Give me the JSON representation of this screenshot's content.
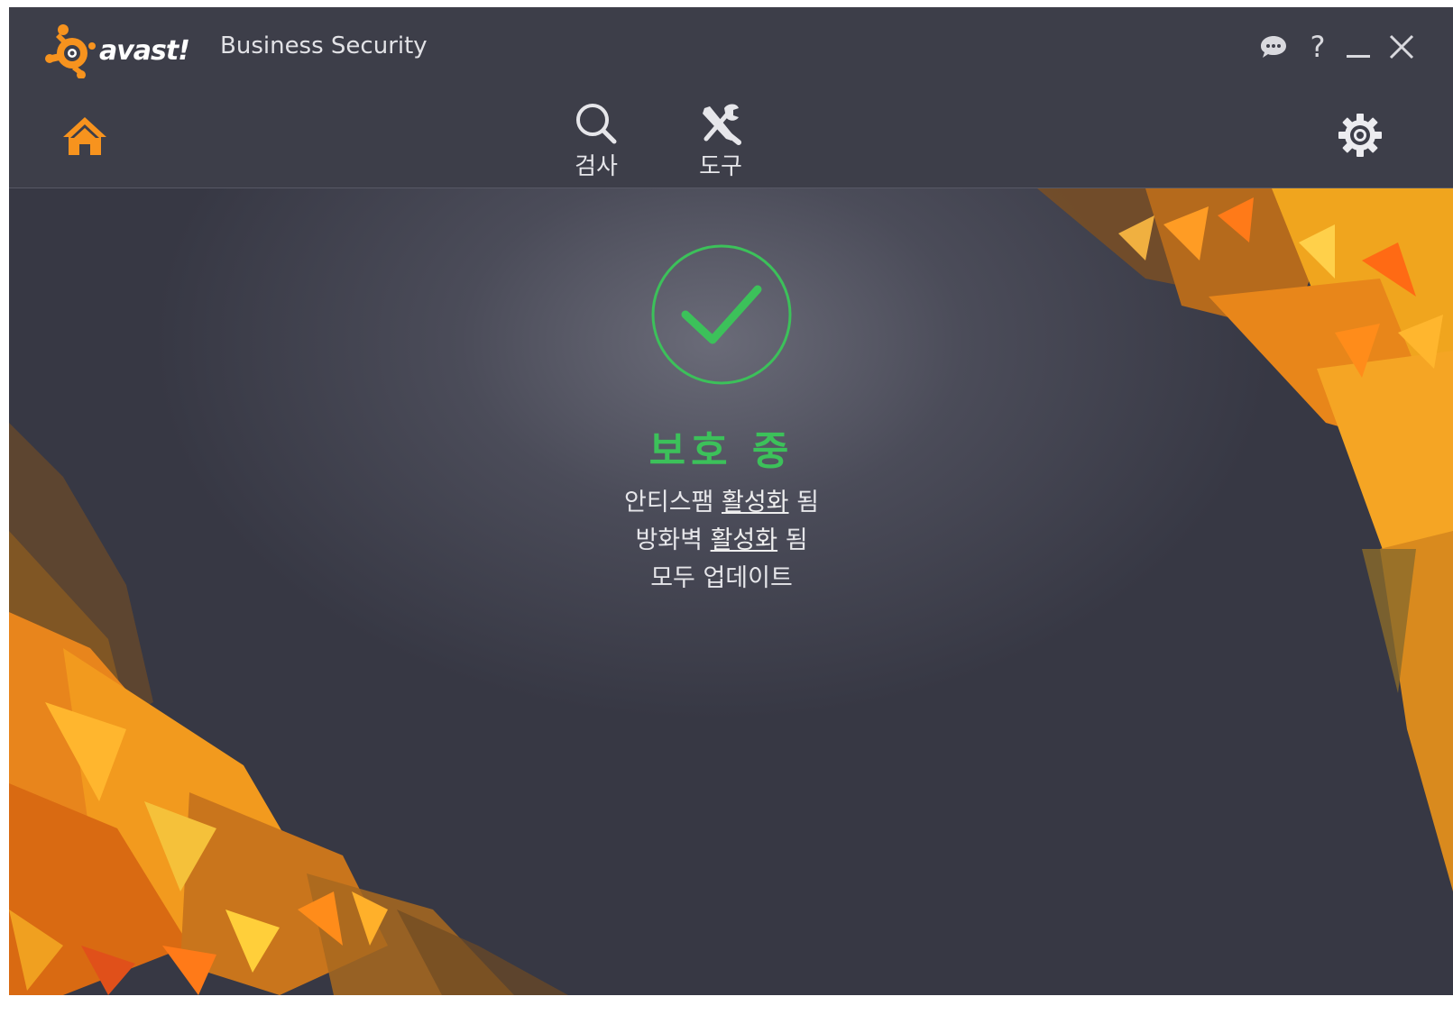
{
  "app": {
    "logo_text": "avast!",
    "product_name": "Business Security",
    "accent_color": "#f7931e",
    "status_color": "#3cc15a"
  },
  "window_controls": {
    "chat_icon": "chat-bubble-icon",
    "help_label": "?",
    "minimize_icon": "minimize-icon",
    "close_icon": "close-icon"
  },
  "nav": {
    "home_icon": "home-icon",
    "items": [
      {
        "label": "검사",
        "icon": "search-icon"
      },
      {
        "label": "도구",
        "icon": "tools-icon"
      }
    ],
    "settings_icon": "gear-icon"
  },
  "status": {
    "icon": "check-circle-icon",
    "title": "보호 중",
    "lines": [
      {
        "prefix": "안티스팸",
        "link": "활성화",
        "suffix": "됨"
      },
      {
        "prefix": "방화벽",
        "link": "활성화",
        "suffix": "됨"
      },
      {
        "prefix": "모두 업데이트",
        "link": "",
        "suffix": ""
      }
    ]
  }
}
